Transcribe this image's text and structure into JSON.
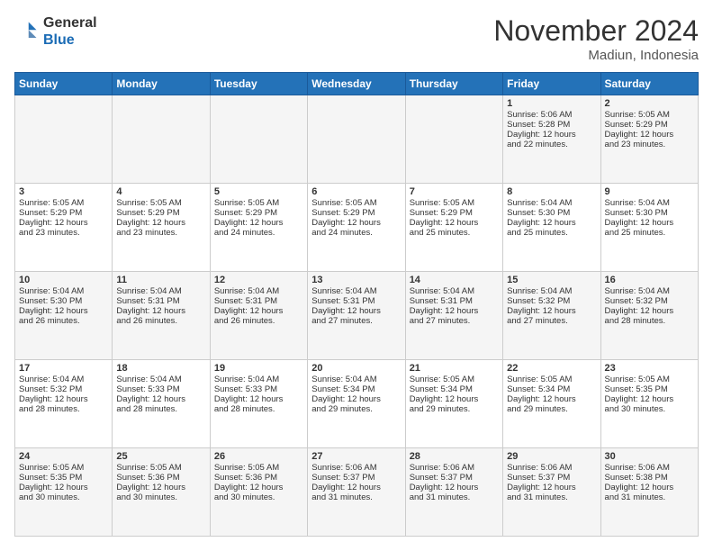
{
  "header": {
    "logo_line1": "General",
    "logo_line2": "Blue",
    "month": "November 2024",
    "location": "Madiun, Indonesia"
  },
  "weekdays": [
    "Sunday",
    "Monday",
    "Tuesday",
    "Wednesday",
    "Thursday",
    "Friday",
    "Saturday"
  ],
  "rows": [
    [
      {
        "day": "",
        "info": ""
      },
      {
        "day": "",
        "info": ""
      },
      {
        "day": "",
        "info": ""
      },
      {
        "day": "",
        "info": ""
      },
      {
        "day": "",
        "info": ""
      },
      {
        "day": "1",
        "info": "Sunrise: 5:06 AM\nSunset: 5:28 PM\nDaylight: 12 hours\nand 22 minutes."
      },
      {
        "day": "2",
        "info": "Sunrise: 5:05 AM\nSunset: 5:29 PM\nDaylight: 12 hours\nand 23 minutes."
      }
    ],
    [
      {
        "day": "3",
        "info": "Sunrise: 5:05 AM\nSunset: 5:29 PM\nDaylight: 12 hours\nand 23 minutes."
      },
      {
        "day": "4",
        "info": "Sunrise: 5:05 AM\nSunset: 5:29 PM\nDaylight: 12 hours\nand 23 minutes."
      },
      {
        "day": "5",
        "info": "Sunrise: 5:05 AM\nSunset: 5:29 PM\nDaylight: 12 hours\nand 24 minutes."
      },
      {
        "day": "6",
        "info": "Sunrise: 5:05 AM\nSunset: 5:29 PM\nDaylight: 12 hours\nand 24 minutes."
      },
      {
        "day": "7",
        "info": "Sunrise: 5:05 AM\nSunset: 5:29 PM\nDaylight: 12 hours\nand 25 minutes."
      },
      {
        "day": "8",
        "info": "Sunrise: 5:04 AM\nSunset: 5:30 PM\nDaylight: 12 hours\nand 25 minutes."
      },
      {
        "day": "9",
        "info": "Sunrise: 5:04 AM\nSunset: 5:30 PM\nDaylight: 12 hours\nand 25 minutes."
      }
    ],
    [
      {
        "day": "10",
        "info": "Sunrise: 5:04 AM\nSunset: 5:30 PM\nDaylight: 12 hours\nand 26 minutes."
      },
      {
        "day": "11",
        "info": "Sunrise: 5:04 AM\nSunset: 5:31 PM\nDaylight: 12 hours\nand 26 minutes."
      },
      {
        "day": "12",
        "info": "Sunrise: 5:04 AM\nSunset: 5:31 PM\nDaylight: 12 hours\nand 26 minutes."
      },
      {
        "day": "13",
        "info": "Sunrise: 5:04 AM\nSunset: 5:31 PM\nDaylight: 12 hours\nand 27 minutes."
      },
      {
        "day": "14",
        "info": "Sunrise: 5:04 AM\nSunset: 5:31 PM\nDaylight: 12 hours\nand 27 minutes."
      },
      {
        "day": "15",
        "info": "Sunrise: 5:04 AM\nSunset: 5:32 PM\nDaylight: 12 hours\nand 27 minutes."
      },
      {
        "day": "16",
        "info": "Sunrise: 5:04 AM\nSunset: 5:32 PM\nDaylight: 12 hours\nand 28 minutes."
      }
    ],
    [
      {
        "day": "17",
        "info": "Sunrise: 5:04 AM\nSunset: 5:32 PM\nDaylight: 12 hours\nand 28 minutes."
      },
      {
        "day": "18",
        "info": "Sunrise: 5:04 AM\nSunset: 5:33 PM\nDaylight: 12 hours\nand 28 minutes."
      },
      {
        "day": "19",
        "info": "Sunrise: 5:04 AM\nSunset: 5:33 PM\nDaylight: 12 hours\nand 28 minutes."
      },
      {
        "day": "20",
        "info": "Sunrise: 5:04 AM\nSunset: 5:34 PM\nDaylight: 12 hours\nand 29 minutes."
      },
      {
        "day": "21",
        "info": "Sunrise: 5:05 AM\nSunset: 5:34 PM\nDaylight: 12 hours\nand 29 minutes."
      },
      {
        "day": "22",
        "info": "Sunrise: 5:05 AM\nSunset: 5:34 PM\nDaylight: 12 hours\nand 29 minutes."
      },
      {
        "day": "23",
        "info": "Sunrise: 5:05 AM\nSunset: 5:35 PM\nDaylight: 12 hours\nand 30 minutes."
      }
    ],
    [
      {
        "day": "24",
        "info": "Sunrise: 5:05 AM\nSunset: 5:35 PM\nDaylight: 12 hours\nand 30 minutes."
      },
      {
        "day": "25",
        "info": "Sunrise: 5:05 AM\nSunset: 5:36 PM\nDaylight: 12 hours\nand 30 minutes."
      },
      {
        "day": "26",
        "info": "Sunrise: 5:05 AM\nSunset: 5:36 PM\nDaylight: 12 hours\nand 30 minutes."
      },
      {
        "day": "27",
        "info": "Sunrise: 5:06 AM\nSunset: 5:37 PM\nDaylight: 12 hours\nand 31 minutes."
      },
      {
        "day": "28",
        "info": "Sunrise: 5:06 AM\nSunset: 5:37 PM\nDaylight: 12 hours\nand 31 minutes."
      },
      {
        "day": "29",
        "info": "Sunrise: 5:06 AM\nSunset: 5:37 PM\nDaylight: 12 hours\nand 31 minutes."
      },
      {
        "day": "30",
        "info": "Sunrise: 5:06 AM\nSunset: 5:38 PM\nDaylight: 12 hours\nand 31 minutes."
      }
    ]
  ]
}
